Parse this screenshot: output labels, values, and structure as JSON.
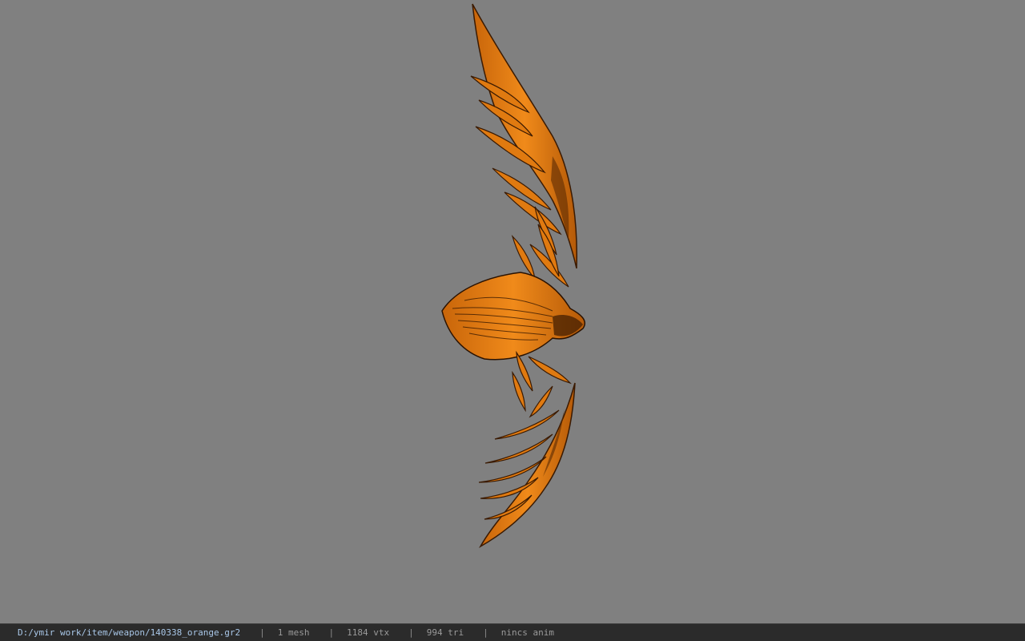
{
  "status_bar": {
    "file_path": "D:/ymir work/item/weapon/140338_orange.gr2",
    "separator": "|",
    "mesh_count": "1 mesh",
    "vertex_count": "1184 vtx",
    "triangle_count": "994 tri",
    "animation": "nincs anim"
  },
  "colors": {
    "viewport_background": "#808080",
    "status_bar_background": "#2b2b2b",
    "model_base": "#e07a10",
    "model_shadow": "#7a3a05"
  },
  "model": {
    "icon": "bow-model-icon"
  }
}
